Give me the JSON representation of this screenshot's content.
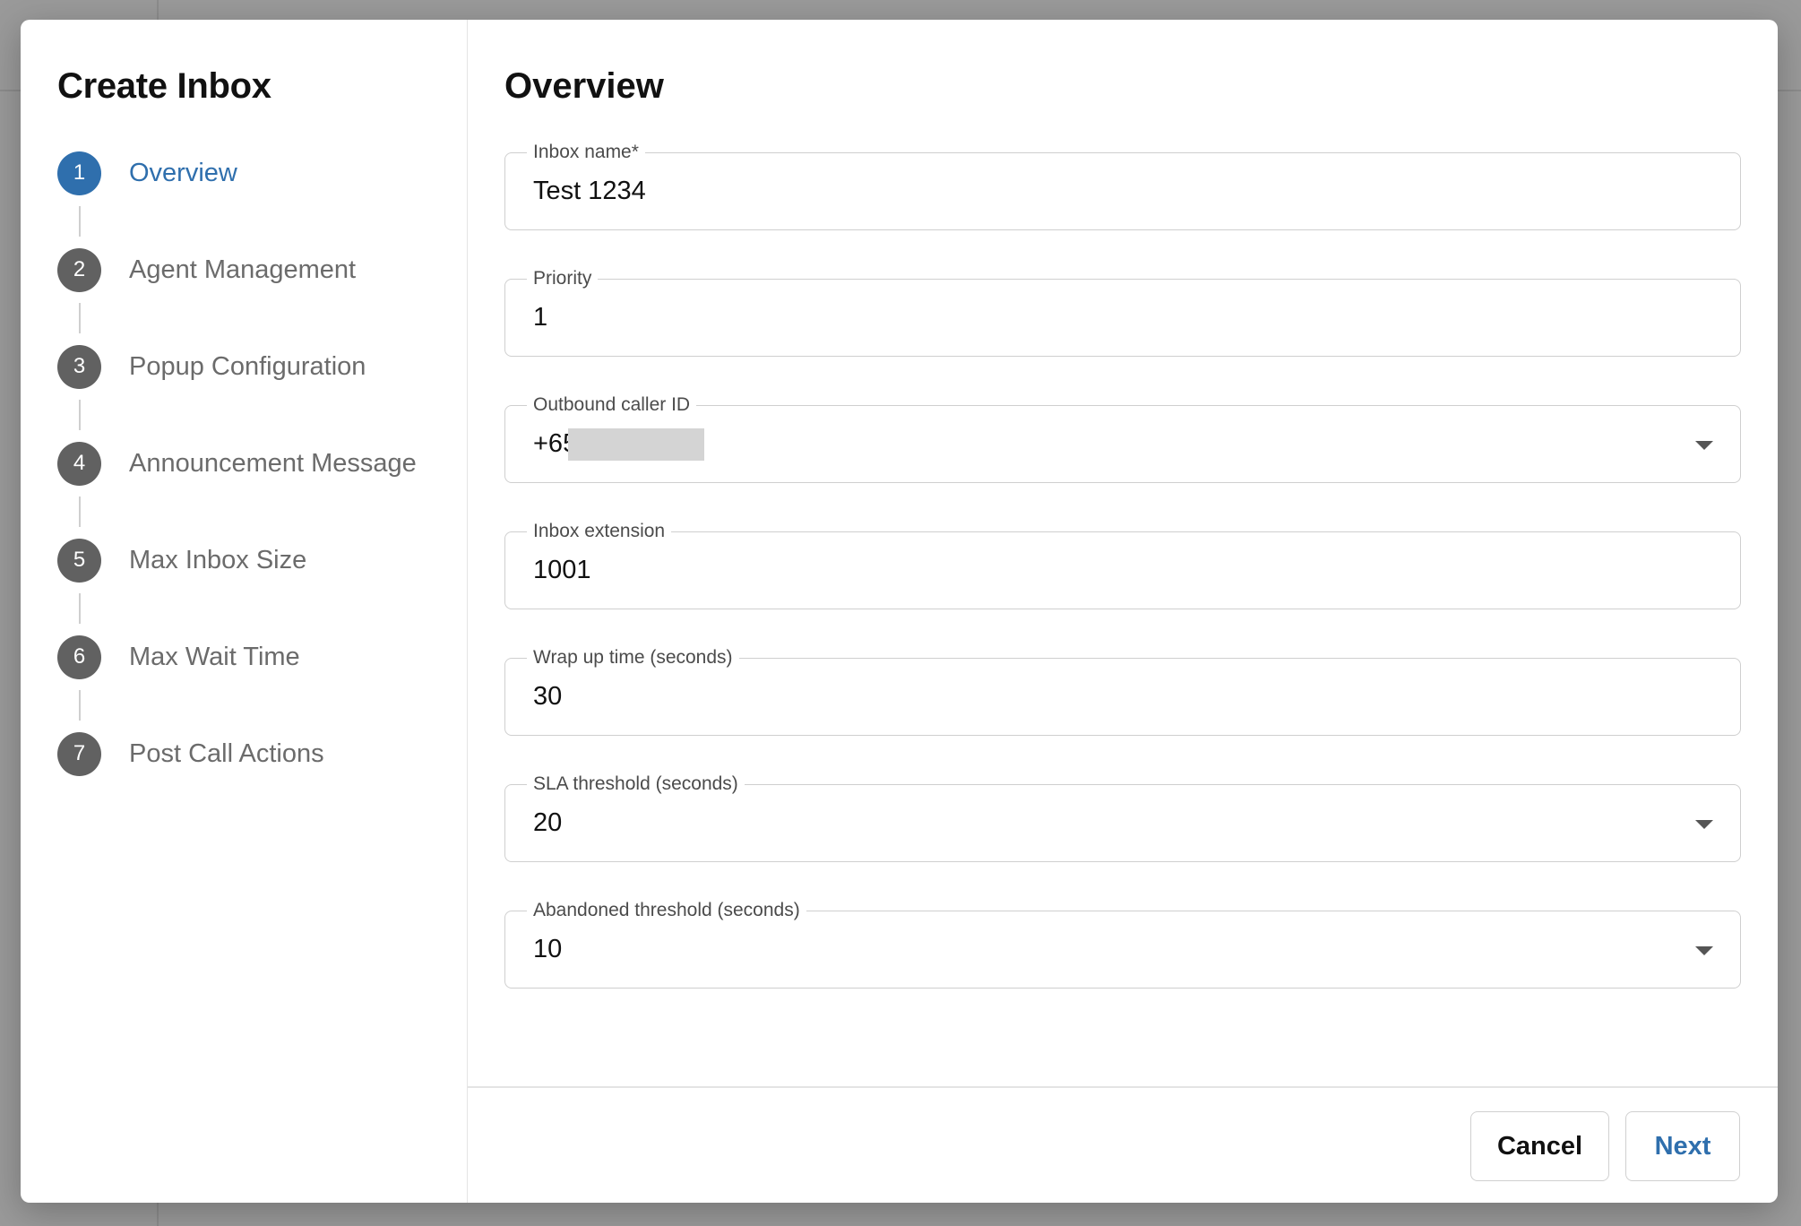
{
  "dialog": {
    "title": "Create Inbox"
  },
  "steps": [
    {
      "number": "1",
      "label": "Overview",
      "active": true
    },
    {
      "number": "2",
      "label": "Agent Management",
      "active": false
    },
    {
      "number": "3",
      "label": "Popup Configuration",
      "active": false
    },
    {
      "number": "4",
      "label": "Announcement Message",
      "active": false
    },
    {
      "number": "5",
      "label": "Max Inbox Size",
      "active": false
    },
    {
      "number": "6",
      "label": "Max Wait Time",
      "active": false
    },
    {
      "number": "7",
      "label": "Post Call Actions",
      "active": false
    }
  ],
  "main": {
    "title": "Overview"
  },
  "fields": {
    "inbox_name": {
      "label": "Inbox name*",
      "value": "Test 1234"
    },
    "priority": {
      "label": "Priority",
      "value": "1"
    },
    "outbound_caller_id": {
      "label": "Outbound caller ID",
      "value": "+65",
      "redacted": true
    },
    "inbox_extension": {
      "label": "Inbox extension",
      "value": "1001"
    },
    "wrap_up_time": {
      "label": "Wrap up time (seconds)",
      "value": "30"
    },
    "sla_threshold": {
      "label": "SLA threshold (seconds)",
      "value": "20"
    },
    "abandoned_threshold": {
      "label": "Abandoned threshold (seconds)",
      "value": "10"
    }
  },
  "footer": {
    "cancel_label": "Cancel",
    "next_label": "Next"
  },
  "colors": {
    "accent": "#2f6fad",
    "step_inactive": "#616161"
  }
}
